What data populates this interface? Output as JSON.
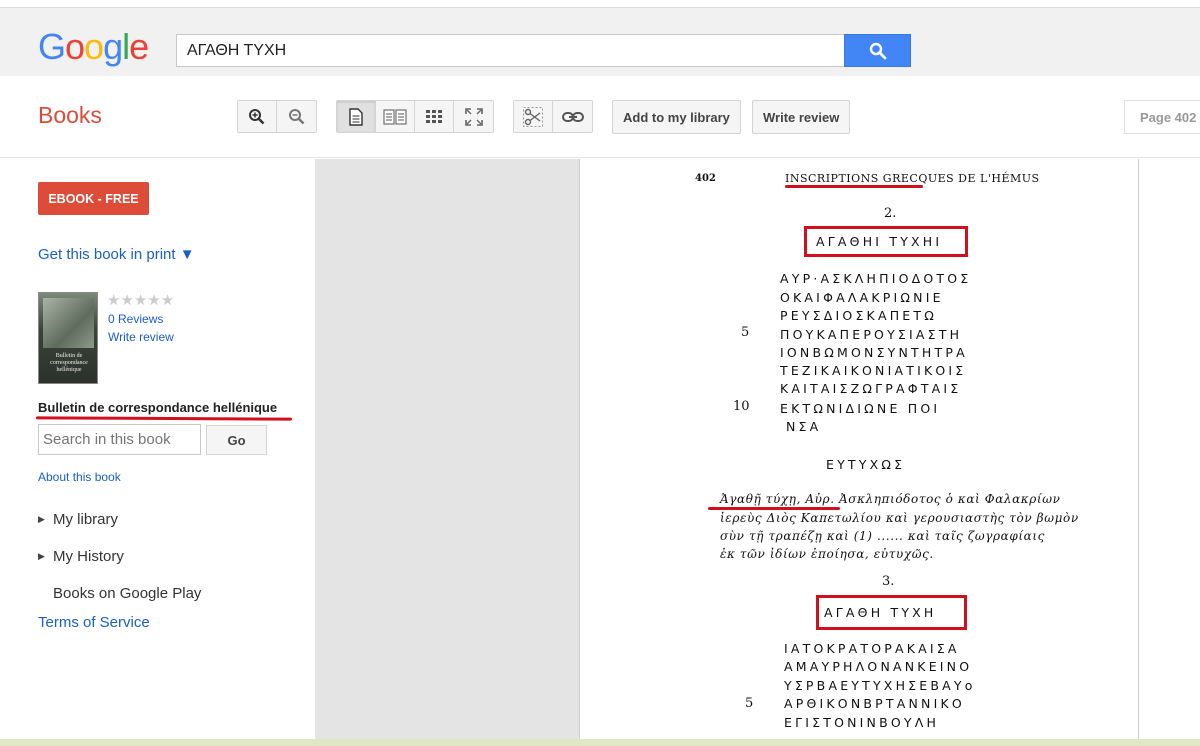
{
  "google_logo": [
    "G",
    "o",
    "o",
    "g",
    "l",
    "e"
  ],
  "logo_colors": [
    "#4285f4",
    "#ea4335",
    "#fbbc05",
    "#4285f4",
    "#34a853",
    "#ea4335"
  ],
  "search": {
    "query": "ΑΓΑΘΗ ΤΥΧΗ"
  },
  "toolbar": {
    "books_label": "Books",
    "add_library": "Add to my library",
    "write_review": "Write review",
    "page_label": "Page 402"
  },
  "sidebar": {
    "ebook_label": "EBOOK - FREE",
    "get_print": "Get this book in print ▼",
    "rating_stars": "★★★★★",
    "reviews": "0 Reviews",
    "write_review": "Write review",
    "book_title": "Bulletin de correspondance hellénique",
    "search_placeholder": "Search in this book",
    "go_label": "Go",
    "about": "About this book",
    "my_library": "My library",
    "my_history": "My History",
    "books_play": "Books on Google Play",
    "tos": "Terms of Service",
    "cover_text": "Bulletin de correspondance hellénique"
  },
  "page": {
    "number": "402",
    "header": "INSCRIPTIONS GRECQUES DE L'HÉMUS",
    "section2": "2.",
    "heading1": "ΑΓΑΘΗΙ ΤΥΧΗΙ",
    "inscription1": [
      "ΑΥΡ·ΑΣΚΛΗΠΙΟΔΟΤΟΣ",
      "ΟΚΑΙΦΑΛΑΚΡΙΩΝΙΕ",
      "ΡΕΥΣΔΙΟΣΚΑΠΕΤΩ",
      "ΠΟΥΚΑΠΕΡΟΥΣΙΑΣΤΗ",
      "ΙΟΝΒΩΜΟΝΣΥΝΤΗΤΡΑ",
      "ΤΕΖΙΚΑΙΚΟΝΙΑΤΙΚΟΙΣ",
      "ΚΑΙΤΑΙΣΖΩΓΡΑΦΤΑΙΣ",
      "ΕΚΤΩΝΙΔΙΩΝΕ ΠΟΙ",
      "ΝΣΑ"
    ],
    "line5": "5",
    "line10": "10",
    "eutychos": "ΕΥΤΥΧΩΣ",
    "transcription": [
      "Ἀγαθῇ τύχῃ, Αὐρ. Ἀσκληπιόδοτος ὁ καὶ Φαλακρίων",
      "ἱερεὺς Διὸς Καπετωλίου καὶ γερουσιαστὴς τὸν βωμὸν",
      "σὺν τῇ τραπέζῃ καὶ (1) ...... καὶ ταῖς ζωγραφίαις",
      "ἐκ τῶν ἰδίων ἐποίησα, εὐτυχῶς."
    ],
    "section3": "3.",
    "heading2": "ΑΓΑΘΗ ΤΥΧΗ",
    "inscription2": [
      "ΙΑΤΟΚΡΑΤΟΡΑΚΑΙΣΑ",
      "ΑΜΑΥΡΗΛΟΝΑΝΚΕΙΝΟ",
      "ΥΣΡΒΑΕΥΤΥΧΗΣΕΒΑΥο",
      "ΑΡΘΙΚΟΝΒΡΤΑΝΝΙΚΟ",
      "ΕΓΙΣΤΟΝΙΝΒΟΥΛΗ"
    ],
    "line5b": "5"
  }
}
